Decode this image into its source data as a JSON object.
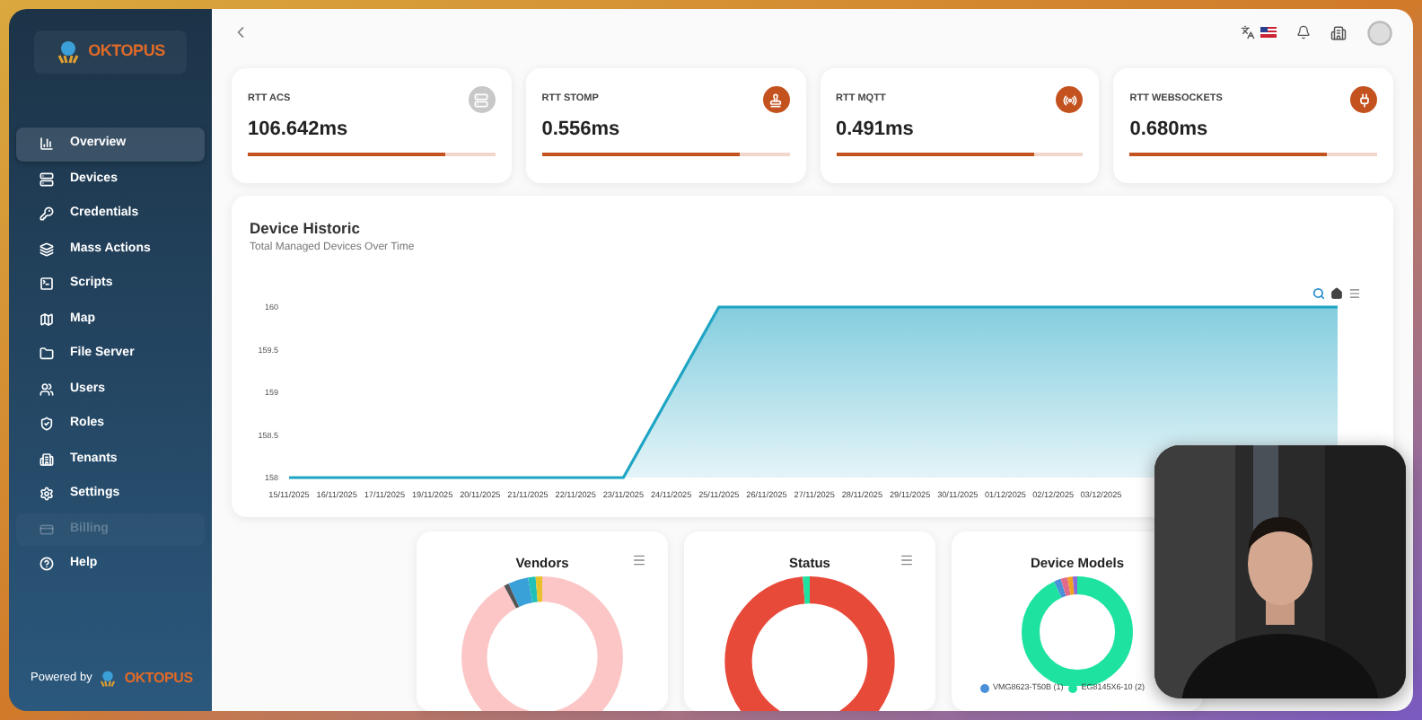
{
  "sidebar": {
    "logo_text": "OKTOPUS",
    "items": [
      {
        "label": "Overview",
        "selected": true,
        "disabled": false
      },
      {
        "label": "Devices",
        "selected": false,
        "disabled": false
      },
      {
        "label": "Credentials",
        "selected": false,
        "disabled": false
      },
      {
        "label": "Mass Actions",
        "selected": false,
        "disabled": false
      },
      {
        "label": "Scripts",
        "selected": false,
        "disabled": false
      },
      {
        "label": "Map",
        "selected": false,
        "disabled": false
      },
      {
        "label": "File Server",
        "selected": false,
        "disabled": false
      },
      {
        "label": "Users",
        "selected": false,
        "disabled": false
      },
      {
        "label": "Roles",
        "selected": false,
        "disabled": false
      },
      {
        "label": "Tenants",
        "selected": false,
        "disabled": false
      },
      {
        "label": "Settings",
        "selected": false,
        "disabled": false
      },
      {
        "label": "Billing",
        "selected": false,
        "disabled": true
      },
      {
        "label": "Help",
        "selected": false,
        "disabled": false
      }
    ],
    "footer": {
      "powered_by": "Powered by",
      "logo_text": "OKTOPUS"
    }
  },
  "metrics": [
    {
      "label": "RTT ACS",
      "value": "106.642ms",
      "level": 0.8,
      "active": false
    },
    {
      "label": "RTT STOMP",
      "value": "0.556ms",
      "level": 0.8,
      "active": true
    },
    {
      "label": "RTT MQTT",
      "value": "0.491ms",
      "level": 0.8,
      "active": true
    },
    {
      "label": "RTT WEBSOCKETS",
      "value": "0.680ms",
      "level": 0.8,
      "active": true
    }
  ],
  "device_historic": {
    "title": "Device Historic",
    "subtitle": "Total Managed Devices Over Time",
    "chart_data": {
      "type": "area",
      "categories": [
        "15/11/2025",
        "16/11/2025",
        "17/11/2025",
        "19/11/2025",
        "20/11/2025",
        "21/11/2025",
        "22/11/2025",
        "23/11/2025",
        "24/11/2025",
        "25/11/2025",
        "26/11/2025",
        "27/11/2025",
        "28/11/2025",
        "29/11/2025",
        "30/11/2025",
        "01/12/2025",
        "02/12/2025",
        "03/12/2025"
      ],
      "series": [
        {
          "color": "#1fa5c4",
          "values": [
            158,
            158,
            158,
            158,
            158,
            158,
            158,
            158,
            159,
            160,
            160,
            160,
            160,
            160,
            160,
            160,
            160,
            160
          ]
        }
      ],
      "ylim": [
        158,
        160
      ],
      "yticks": [
        158,
        158.5,
        159,
        159.5,
        160
      ]
    }
  },
  "donuts": [
    {
      "title": "Vendors",
      "menu": true
    },
    {
      "title": "Status",
      "menu": true
    },
    {
      "title": "Device Models",
      "menu": false,
      "legend": [
        {
          "label": "VMG8623-T50B (1)",
          "color": "#4a90d9"
        },
        {
          "label": "EG8145X6-10 (2)",
          "color": "#1ee3a0"
        }
      ]
    }
  ]
}
